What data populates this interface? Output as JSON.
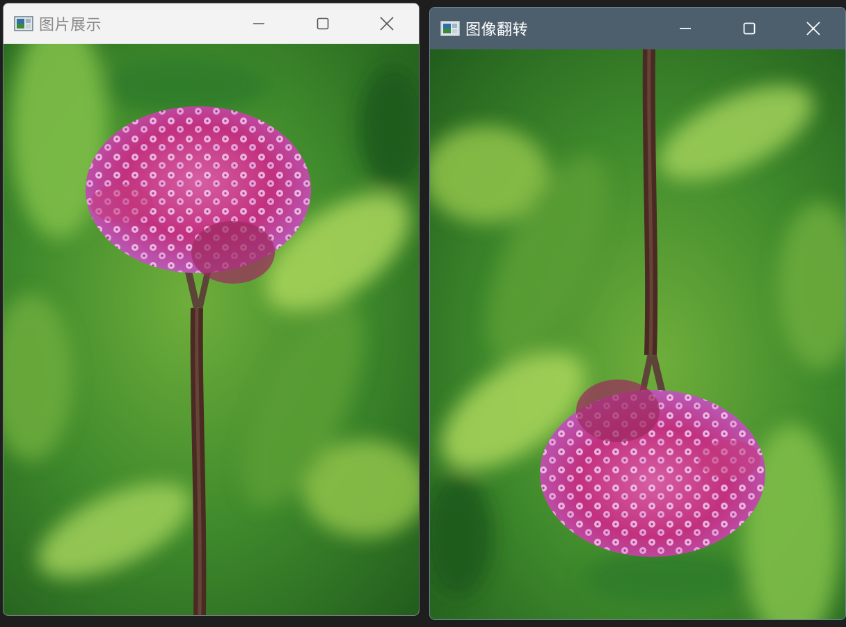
{
  "windows": {
    "original": {
      "title": "图片展示",
      "icon": "image-app-icon"
    },
    "flipped": {
      "title": "图像翻转",
      "icon": "image-app-icon"
    }
  },
  "controls": {
    "minimize_icon": "minimize-icon",
    "maximize_icon": "maximize-icon",
    "close_icon": "close-icon"
  },
  "colors": {
    "left_titlebar": "#f3f3f3",
    "right_titlebar": "#4d5f6d",
    "foliage_dark": "#1f5a1c",
    "foliage_light": "#8cc04a",
    "stem": "#4a2a22",
    "petal_pink": "#e7a6dc",
    "petal_magenta": "#c2307e"
  }
}
